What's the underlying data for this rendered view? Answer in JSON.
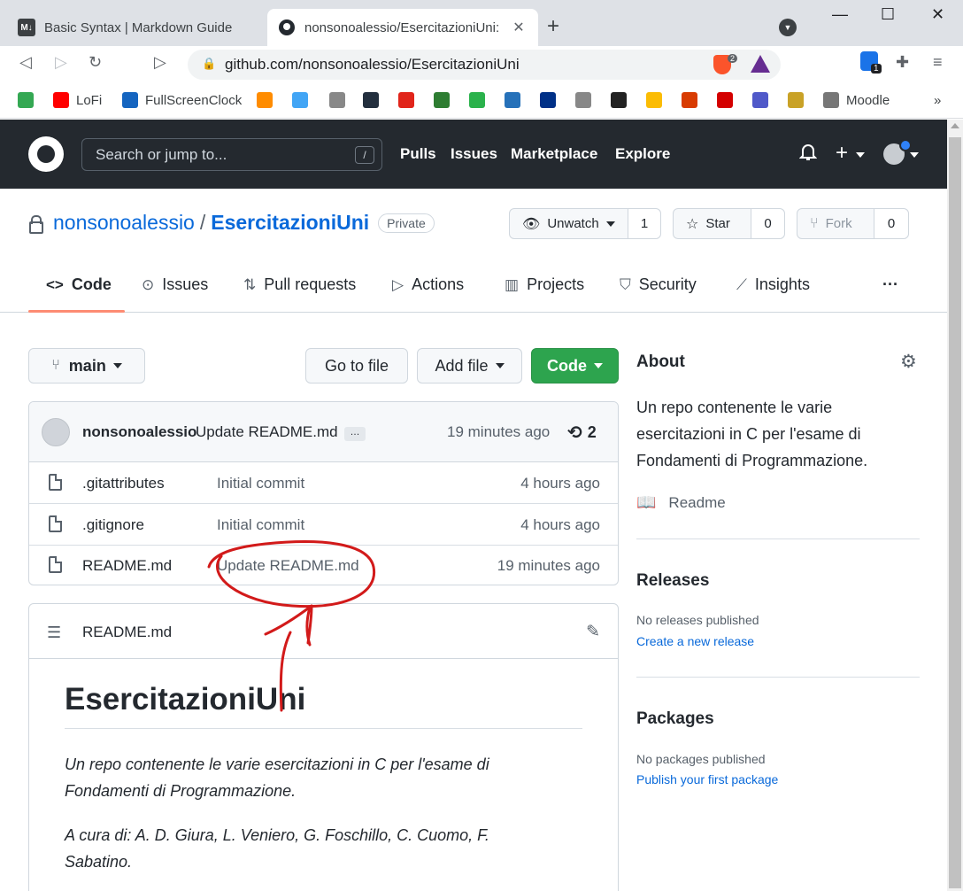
{
  "browser": {
    "tabs": [
      {
        "title": "Basic Syntax | Markdown Guide",
        "favicon": "M↓",
        "active": false
      },
      {
        "title": "nonsonoalessio/EsercitazioniUni: ",
        "favicon": "github-icon",
        "active": true
      }
    ],
    "new_tab": "+",
    "url": "github.com/nonsonoalessio/EsercitazioniUni",
    "brave_badge": "2",
    "extension_badge": "1",
    "bookmarks": [
      {
        "label": "",
        "icon": "bookmark-green-icon",
        "color": "#34a853"
      },
      {
        "label": "LoFi",
        "icon": "youtube-icon",
        "color": "#ff0000"
      },
      {
        "label": "FullScreenClock",
        "icon": "clock-dp-icon",
        "color": "#1565c0"
      },
      {
        "label": "",
        "icon": "rss-icon",
        "color": "#ff8c00"
      },
      {
        "label": "",
        "icon": "flutter-icon",
        "color": "#42a5f5"
      },
      {
        "label": "",
        "icon": "apple-icon",
        "color": "#888888"
      },
      {
        "label": "",
        "icon": "aws-icon",
        "color": "#232f3e"
      },
      {
        "label": "",
        "icon": "adobe-icon",
        "color": "#e1251b"
      },
      {
        "label": "",
        "icon": "notion-n-icon",
        "color": "#2e7d32"
      },
      {
        "label": "",
        "icon": "feedly-icon",
        "color": "#2bb24c"
      },
      {
        "label": "",
        "icon": "amex-icon",
        "color": "#2671b9"
      },
      {
        "label": "",
        "icon": "paypal-icon",
        "color": "#003087"
      },
      {
        "label": "",
        "icon": "apple-icon",
        "color": "#888888"
      },
      {
        "label": "",
        "icon": "dark-square-icon",
        "color": "#222222"
      },
      {
        "label": "",
        "icon": "google-drive-icon",
        "color": "#fbbc04"
      },
      {
        "label": "",
        "icon": "office-icon",
        "color": "#d83b01"
      },
      {
        "label": "",
        "icon": "acrobat-icon",
        "color": "#d40000"
      },
      {
        "label": "",
        "icon": "teams-icon",
        "color": "#5059c9"
      },
      {
        "label": "",
        "icon": "university-seal-icon",
        "color": "#c9a227"
      },
      {
        "label": "Moodle",
        "icon": "moodle-icon",
        "color": "#777777"
      }
    ],
    "bookmarks_more": "»"
  },
  "github": {
    "search_placeholder": "Search or jump to...",
    "search_key": "/",
    "nav": [
      "Pulls",
      "Issues",
      "Marketplace",
      "Explore"
    ],
    "plus": "+"
  },
  "repo": {
    "owner": "nonsonoalessio",
    "sep": "/",
    "name": "EsercitazioniUni",
    "visibility": "Private",
    "unwatch_label": "Unwatch",
    "unwatch_count": "1",
    "star_label": "Star",
    "star_count": "0",
    "fork_label": "Fork",
    "fork_count": "0",
    "tabs": [
      "Code",
      "Issues",
      "Pull requests",
      "Actions",
      "Projects",
      "Security",
      "Insights"
    ],
    "more": "···"
  },
  "filenav": {
    "branch": "main",
    "go_to_file": "Go to file",
    "add_file": "Add file",
    "code": "Code"
  },
  "latest_commit": {
    "author": "nonsonoalessio",
    "message": "Update README.md",
    "ellipsis": "…",
    "time": "19 minutes ago",
    "commits": "2"
  },
  "files": [
    {
      "name": ".gitattributes",
      "message": "Initial commit",
      "time": "4 hours ago"
    },
    {
      "name": ".gitignore",
      "message": "Initial commit",
      "time": "4 hours ago"
    },
    {
      "name": "README.md",
      "message": "Update README.md",
      "time": "19 minutes ago"
    }
  ],
  "readme": {
    "filename": "README.md",
    "heading": "EsercitazioniUni",
    "para1": "Un repo contenente le varie esercitazioni in C per l'esame di Fondamenti di Programmazione.",
    "para2": "A cura di: A. D. Giura, L. Veniero, G. Foschillo, C. Cuomo, F. Sabatino."
  },
  "sidebar": {
    "about_title": "About",
    "about_desc": "Un repo contenente le varie esercitazioni in C per l'esame di Fondamenti di Programmazione.",
    "readme_label": "Readme",
    "releases_title": "Releases",
    "releases_none": "No releases published",
    "releases_link": "Create a new release",
    "packages_title": "Packages",
    "packages_none": "No packages published",
    "packages_link": "Publish your first package"
  },
  "annotation": {
    "color": "#d21a1a",
    "shape": "red-circle-and-arrow"
  }
}
